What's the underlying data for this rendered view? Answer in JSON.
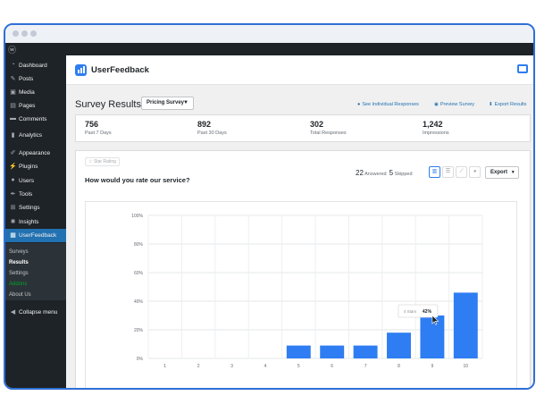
{
  "sidebar": {
    "items": [
      {
        "label": "Dashboard",
        "icon": "dashboard-icon",
        "glyph": "◔"
      },
      {
        "label": "Posts",
        "icon": "pin-icon",
        "glyph": "✎"
      },
      {
        "label": "Media",
        "icon": "media-icon",
        "glyph": "▣"
      },
      {
        "label": "Pages",
        "icon": "pages-icon",
        "glyph": "▤"
      },
      {
        "label": "Comments",
        "icon": "comments-icon",
        "glyph": "▬"
      },
      {
        "label": "Analytics",
        "icon": "analytics-icon",
        "glyph": "▮"
      },
      {
        "label": "Appearance",
        "icon": "appearance-icon",
        "glyph": "✐"
      },
      {
        "label": "Plugins",
        "icon": "plugins-icon",
        "glyph": "⚡"
      },
      {
        "label": "Users",
        "icon": "users-icon",
        "glyph": "●"
      },
      {
        "label": "Tools",
        "icon": "tools-icon",
        "glyph": "✒"
      },
      {
        "label": "Settings",
        "icon": "settings-icon",
        "glyph": "⊞"
      },
      {
        "label": "Insights",
        "icon": "insights-icon",
        "glyph": "✺"
      },
      {
        "label": "UserFeedback",
        "icon": "userfeedback-icon",
        "glyph": "▦"
      }
    ],
    "submenu": [
      "Surveys",
      "Results",
      "Settings",
      "Addons",
      "About Us"
    ],
    "collapse": "Collapse menu"
  },
  "header": {
    "app_name": "UserFeedback"
  },
  "page": {
    "title": "Survey Results",
    "survey_select": "Pricing Survey",
    "links": {
      "individual": "See Individual Responses",
      "preview": "Preview Survey",
      "export": "Export Results"
    }
  },
  "stats": [
    {
      "value": "756",
      "label": "Past 7 Days"
    },
    {
      "value": "892",
      "label": "Past 30 Days"
    },
    {
      "value": "302",
      "label": "Total Responses"
    },
    {
      "value": "1,242",
      "label": "Impressions"
    }
  ],
  "question": {
    "type": "Star Rating",
    "text": "How would you rate our service?",
    "answered_count": "22",
    "answered_label": "Answered",
    "skipped_count": "5",
    "skipped_label": "Skipped",
    "export_label": "Export"
  },
  "chart_data": {
    "type": "bar",
    "categories": [
      "1",
      "2",
      "3",
      "4",
      "5",
      "6",
      "7",
      "8",
      "9",
      "10"
    ],
    "values": [
      0,
      0,
      0,
      0,
      9,
      9,
      9,
      18,
      30,
      46
    ],
    "y_ticks": [
      "0%",
      "20%",
      "40%",
      "60%",
      "80%",
      "100%"
    ],
    "ylim": [
      0,
      100
    ],
    "grid": true,
    "bar_color": "#2e7df2",
    "tooltip": {
      "label": "4 Stars",
      "value": "42%"
    }
  }
}
